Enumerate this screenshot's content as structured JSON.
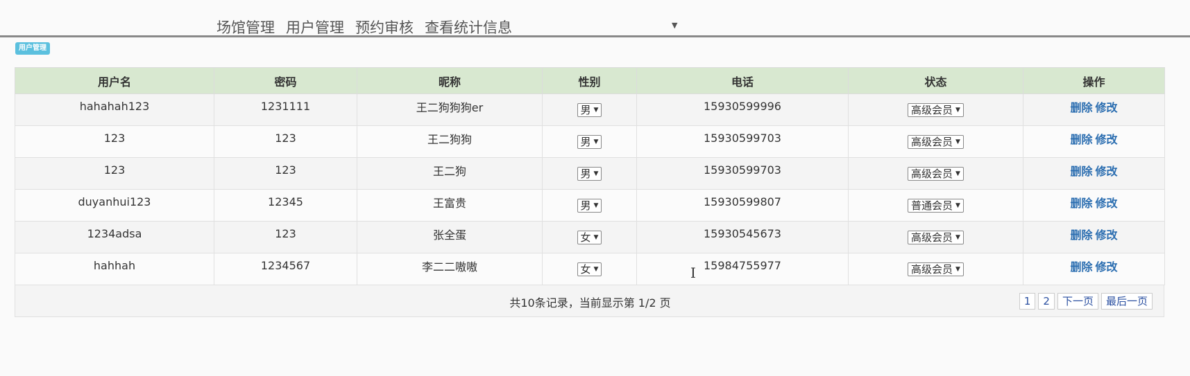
{
  "nav": {
    "items": [
      "场馆管理",
      "用户管理",
      "预约审核",
      "查看统计信息"
    ],
    "caret": "▼"
  },
  "badge": "用户管理",
  "table": {
    "headers": [
      "用户名",
      "密码",
      "昵称",
      "性别",
      "电话",
      "状态",
      "操作"
    ],
    "rows": [
      {
        "username": "hahahah123",
        "password": "1231111",
        "nickname": "王二狗狗狗er",
        "gender": "男",
        "phone": "15930599996",
        "status": "高级会员"
      },
      {
        "username": "123",
        "password": "123",
        "nickname": "王二狗狗",
        "gender": "男",
        "phone": "15930599703",
        "status": "高级会员"
      },
      {
        "username": "123",
        "password": "123",
        "nickname": "王二狗",
        "gender": "男",
        "phone": "15930599703",
        "status": "高级会员"
      },
      {
        "username": "duyanhui123",
        "password": "12345",
        "nickname": "王富贵",
        "gender": "男",
        "phone": "15930599807",
        "status": "普通会员"
      },
      {
        "username": "1234adsa",
        "password": "123",
        "nickname": "张全蛋",
        "gender": "女",
        "phone": "15930545673",
        "status": "高级会员"
      },
      {
        "username": "hahhah",
        "password": "1234567",
        "nickname": "李二二嗷嗷",
        "gender": "女",
        "phone": "15984755977",
        "status": "高级会员"
      }
    ],
    "delete_label": "删除",
    "edit_label": "修改",
    "select_caret": "▼"
  },
  "footer": {
    "info": "共10条记录，当前显示第 1/2 页",
    "pages": [
      "1",
      "2",
      "下一页",
      "最后一页"
    ]
  }
}
